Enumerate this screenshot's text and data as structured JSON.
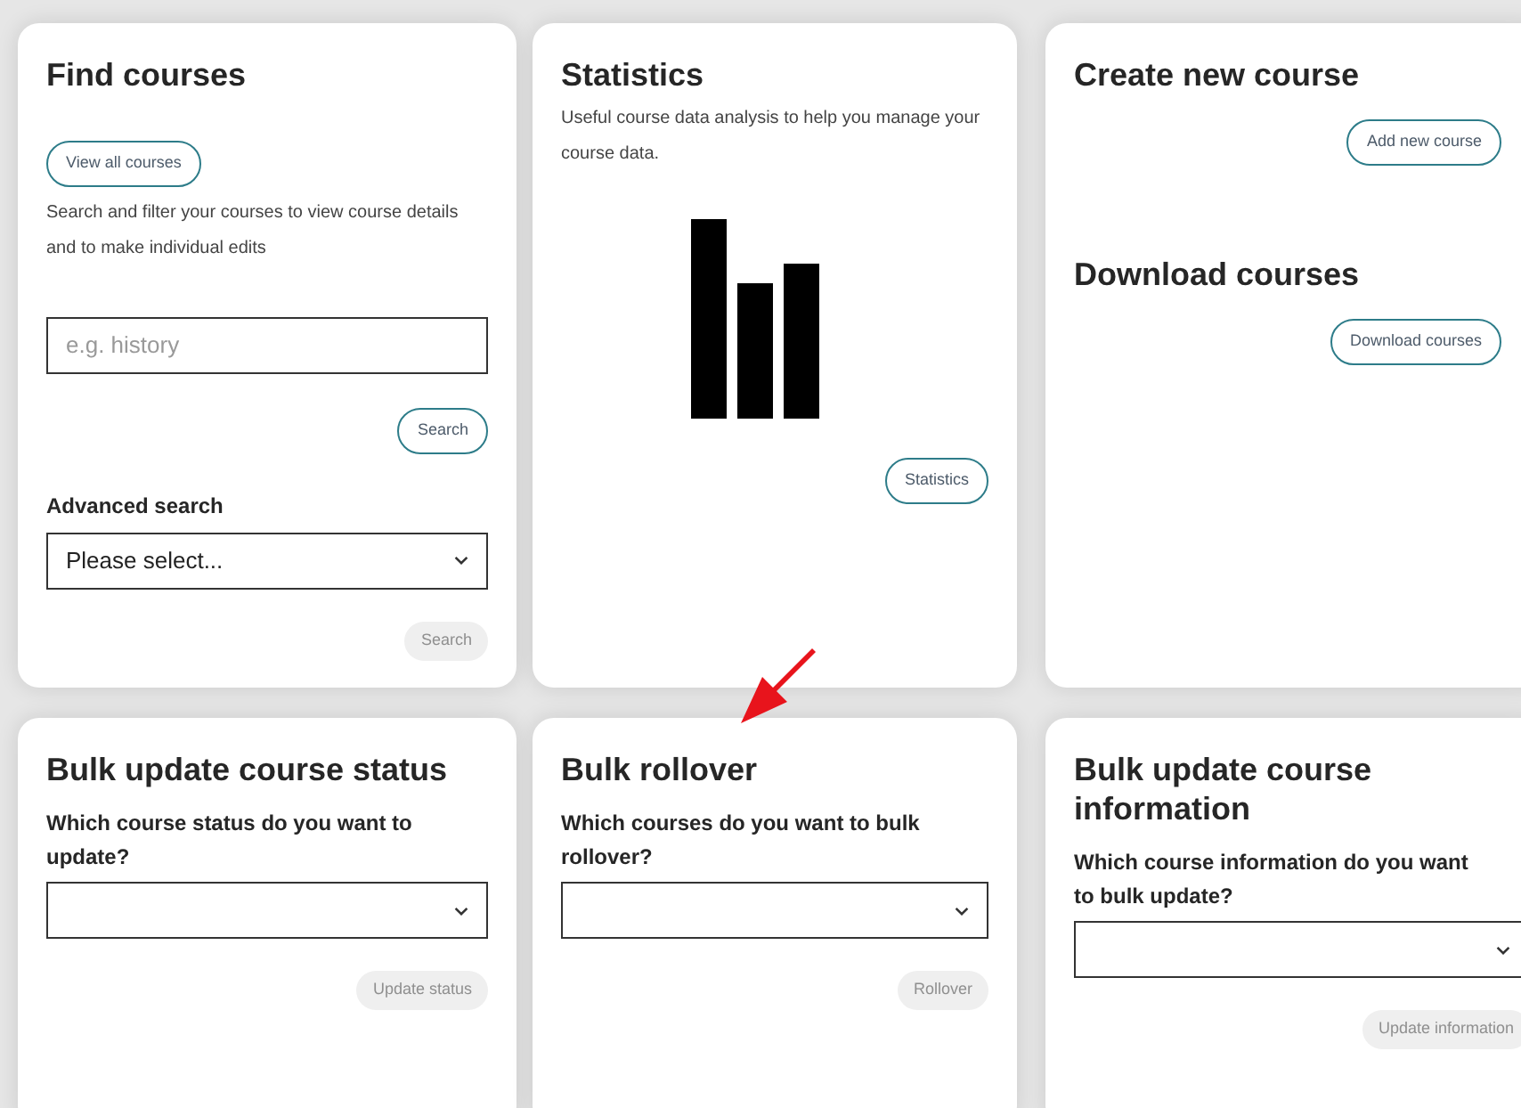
{
  "cards": [
    {
      "kind": "find",
      "title": "Find courses",
      "view_all_button": "View all courses",
      "description": "Search and filter your courses to view course details and to make individual edits",
      "search_field": {
        "placeholder": "e.g. history"
      },
      "search_button": {
        "label": "Search",
        "disabled": false
      },
      "advanced_label": "Advanced search",
      "advanced_select": {
        "value": "Please select..."
      },
      "advanced_button": {
        "label": "Search",
        "disabled": true
      }
    },
    {
      "kind": "stats",
      "title": "Statistics",
      "description": "Useful course data analysis to help you manage your course data.",
      "button": {
        "label": "Statistics",
        "disabled": false
      }
    },
    {
      "kind": "actions",
      "sections": [
        {
          "title": "Create new course",
          "button": {
            "label": "Add new course",
            "disabled": false
          }
        },
        {
          "title": "Download courses",
          "button": {
            "label": "Download courses",
            "disabled": false
          }
        }
      ]
    },
    {
      "kind": "bulk",
      "title": "Bulk update course status",
      "question": "Which course status do you want to update?",
      "button": {
        "label": "Update status",
        "disabled": true
      }
    },
    {
      "kind": "bulk",
      "title": "Bulk rollover",
      "question": "Which courses do you want to bulk rollover?",
      "button": {
        "label": "Rollover",
        "disabled": true
      }
    },
    {
      "kind": "bulk",
      "title": "Bulk update course information",
      "question": "Which course information do you want to bulk update?",
      "button": {
        "label": "Update information",
        "disabled": true
      }
    }
  ]
}
